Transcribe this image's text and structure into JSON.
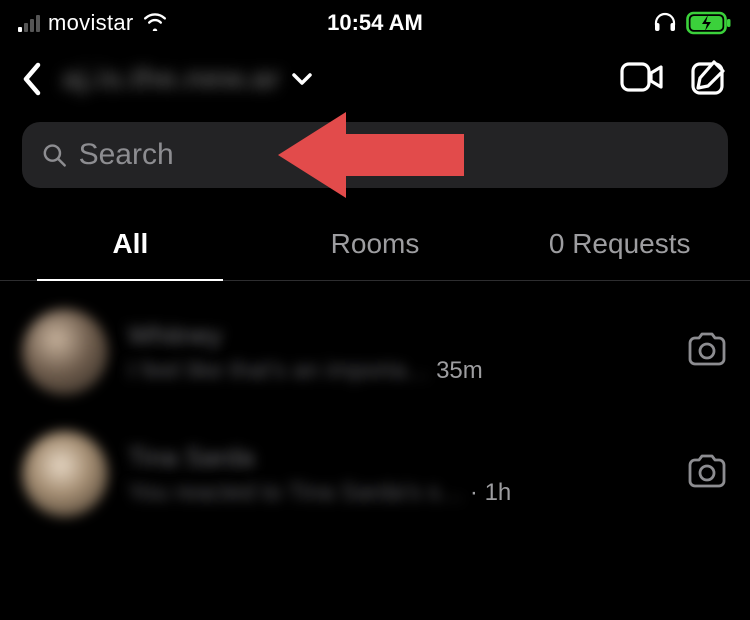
{
  "status": {
    "carrier": "movistar",
    "time": "10:54 AM"
  },
  "header": {
    "account_name_blurred": "aj.is.the.new.ar"
  },
  "search": {
    "placeholder": "Search"
  },
  "tabs": {
    "all": "All",
    "rooms": "Rooms",
    "requests_count": 0,
    "requests_label": "0 Requests"
  },
  "conversations": [
    {
      "name_blurred": "Whitney",
      "preview_blurred": "I feel like that's an importa…",
      "time": "35m"
    },
    {
      "name_blurred": "Tina Sarda",
      "preview_blurred": "You reacted to Tina Sarda's s…",
      "time": "· 1h"
    }
  ],
  "annotation": {
    "arrow_color": "#E24B4B"
  }
}
